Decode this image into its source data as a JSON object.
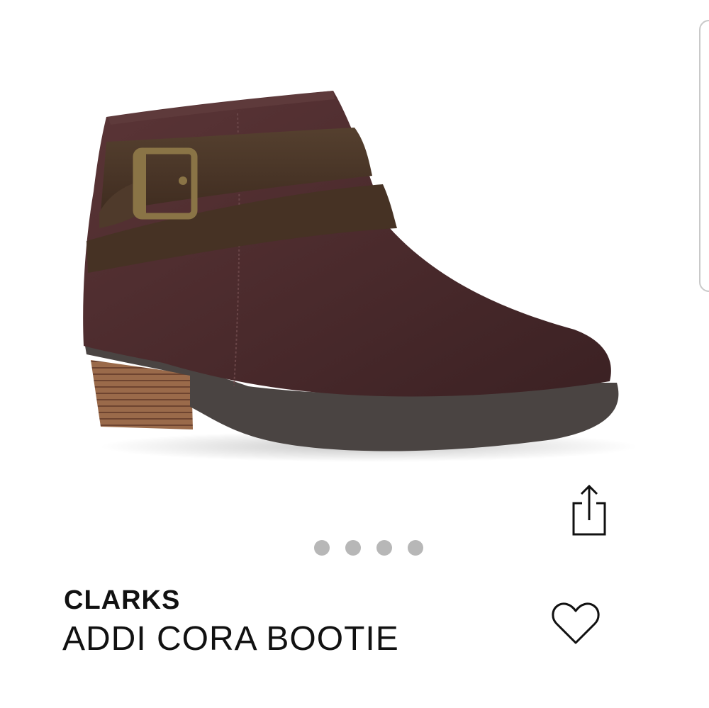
{
  "product": {
    "brand": "CLARKS",
    "name": "ADDI CORA BOOTIE"
  },
  "gallery": {
    "image_count": 4,
    "active_index": 0
  },
  "icons": {
    "share": "share-icon",
    "favorite": "heart-icon"
  },
  "colors": {
    "suede": "#4a2a2c",
    "strap": "#4b3528",
    "sole": "#4a4442",
    "heel_stack": "#8a5a3e",
    "dot": "#b7b7b7",
    "text": "#111111"
  }
}
